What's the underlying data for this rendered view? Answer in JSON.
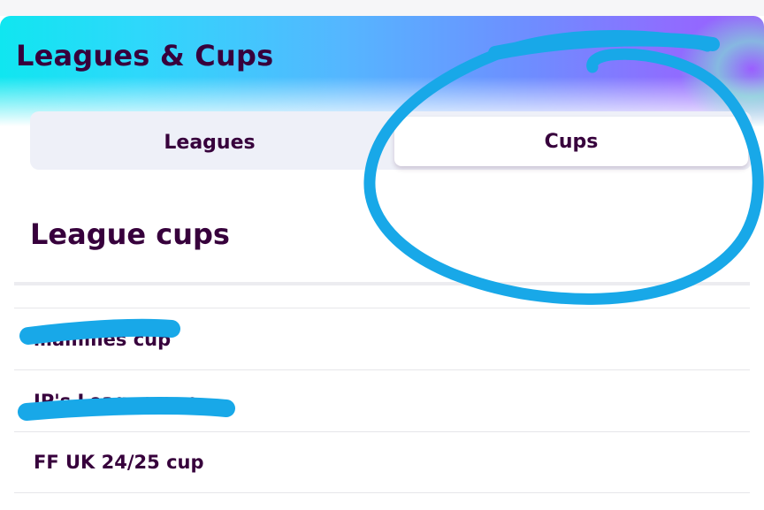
{
  "header": {
    "title": "Leagues & Cups"
  },
  "tabs": [
    {
      "label": "Leagues",
      "selected": false
    },
    {
      "label": "Cups",
      "selected": true
    }
  ],
  "section": {
    "title": "League cups"
  },
  "cups": [
    {
      "name": "…amilies cup",
      "redacted": true
    },
    {
      "name": "JP's League cup",
      "redacted": true
    },
    {
      "name": "FF UK 24/25 cup",
      "redacted": false
    }
  ],
  "colors": {
    "primary_text": "#37003c",
    "annotation_ink": "#18a8e8",
    "segment_bg": "#eef0f8"
  }
}
